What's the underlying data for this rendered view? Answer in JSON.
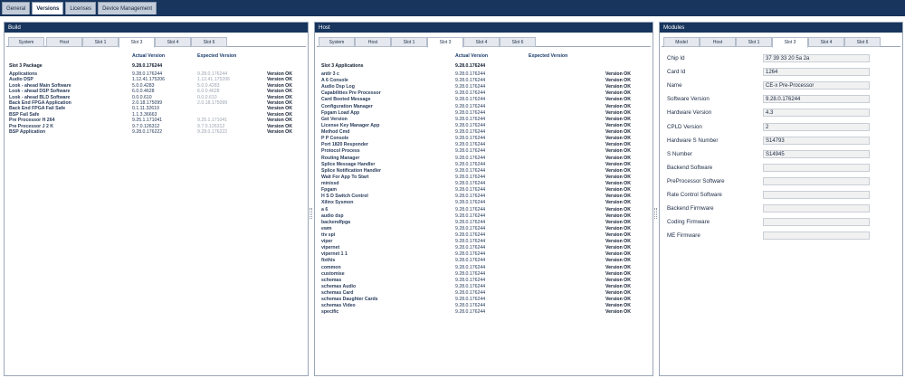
{
  "top_tabs": [
    "General",
    "Versions",
    "Licenses",
    "Device Management"
  ],
  "build": {
    "title": "Build",
    "tabs": [
      "System",
      "Host",
      "Slot 1",
      "Slot 3",
      "Slot 4",
      "Slot 6"
    ],
    "active_tab": "Slot 3",
    "col_actual": "Actual Version",
    "col_expected": "Expected Version",
    "package_label": "Slot 3 Package",
    "package_version": "9.28.0.176244",
    "rows": [
      {
        "name": "Applications",
        "actual": "9.28.0.176244",
        "expected": "9.28.0.176244",
        "status": "Version OK"
      },
      {
        "name": "Audio DSP",
        "actual": "1.12.41.175206",
        "expected": "1.12.41.175206",
        "status": "Version OK"
      },
      {
        "name": "Look - ahead Main Software",
        "actual": "5.0.0.4283",
        "expected": "5.0.0.4283",
        "status": "Version OK"
      },
      {
        "name": "Look - ahead DSP Software",
        "actual": "6.0.0.4628",
        "expected": "6.0.0.4628",
        "status": "Version OK"
      },
      {
        "name": "Look - ahead BLD Software",
        "actual": "0.0.0.610",
        "expected": "0.0.0.610",
        "status": "Version OK"
      },
      {
        "name": "Back End FPGA Application",
        "actual": "2.0.18.175099",
        "expected": "2.0.18.175099",
        "status": "Version OK"
      },
      {
        "name": "Back End FPGA Fail Safe",
        "actual": "0.1.11.32619",
        "expected": "",
        "status": "Version OK"
      },
      {
        "name": "BSP Fail Safe",
        "actual": "1.1.3.36663",
        "expected": "",
        "status": "Version OK"
      },
      {
        "name": "Pre Processor H 264",
        "actual": "9.25.1.171041",
        "expected": "9.25.1.171041",
        "status": "Version OK"
      },
      {
        "name": "Pre Processor J 2 K",
        "actual": "9.7.0.126312",
        "expected": "9.7.0.126312",
        "status": "Version OK"
      },
      {
        "name": "BSP Application",
        "actual": "9.28.0.176222",
        "expected": "9.28.0.176222",
        "status": "Version OK"
      }
    ]
  },
  "host": {
    "title": "Host",
    "tabs": [
      "System",
      "Host",
      "Slot 1",
      "Slot 3",
      "Slot 4",
      "Slot 6"
    ],
    "active_tab": "Slot 3",
    "col_actual": "Actual Version",
    "col_expected": "Expected Version",
    "package_label": "Slot 3 Applications",
    "package_version": "9.28.0.176244",
    "version": "9.28.0.176244",
    "status": "Version OK",
    "rows": [
      "antlr 3 c",
      "A 6 Console",
      "Audio Dsp Log",
      "Capabilities Pre Processor",
      "Card Booted Message",
      "Configuration Manager",
      "Fpgam Load App",
      "Get Version",
      "License Key Manager App",
      "Method Cmd",
      "P P Console",
      "Port 1820 Responder",
      "Protocol Process",
      "Routing Manager",
      "Splice Message Handler",
      "Splice Notification Handler",
      "Wait For App To Start",
      "minixsd",
      "Fpgam",
      "H S D Switch Control",
      "Xilinx Sysmon",
      "a 6",
      "audio dsp",
      "backendfpga",
      "ewm",
      "ttv spi",
      "viper",
      "vipernet",
      "vipernet 1 1",
      "fixthis",
      "common",
      "customise",
      "schemas",
      "schemas Audio",
      "schemas Card",
      "schemas Daughter Cards",
      "schemas Video",
      "specific"
    ]
  },
  "modules": {
    "title": "Modules",
    "tabs": [
      "Model",
      "Host",
      "Slot 1",
      "Slot 3",
      "Slot 4",
      "Slot 6"
    ],
    "active_tab": "Slot 3",
    "fields": [
      {
        "label": "Chip Id",
        "value": "37 39 33 20 5a 2a"
      },
      {
        "label": "Card Id",
        "value": "1264"
      },
      {
        "label": "Name",
        "value": "CE-x Pre-Processor"
      },
      {
        "label": "Software Version",
        "value": "9.28.0.176244"
      },
      {
        "label": "Hardware Version",
        "value": "4.3"
      },
      {
        "label": "CPLD Version",
        "value": "2"
      },
      {
        "label": "Hardware S Number",
        "value": "S14793"
      },
      {
        "label": "S Number",
        "value": "S14945"
      },
      {
        "label": "Backend Software",
        "value": ""
      },
      {
        "label": "PreProcessor Software",
        "value": ""
      },
      {
        "label": "Rate Control Software",
        "value": ""
      },
      {
        "label": "Backend Firmware",
        "value": ""
      },
      {
        "label": "Coding Firmware",
        "value": ""
      },
      {
        "label": "ME Firmware",
        "value": ""
      }
    ]
  },
  "colors": {
    "header": "#17355d",
    "tab_bg": "#c3ccd9"
  }
}
